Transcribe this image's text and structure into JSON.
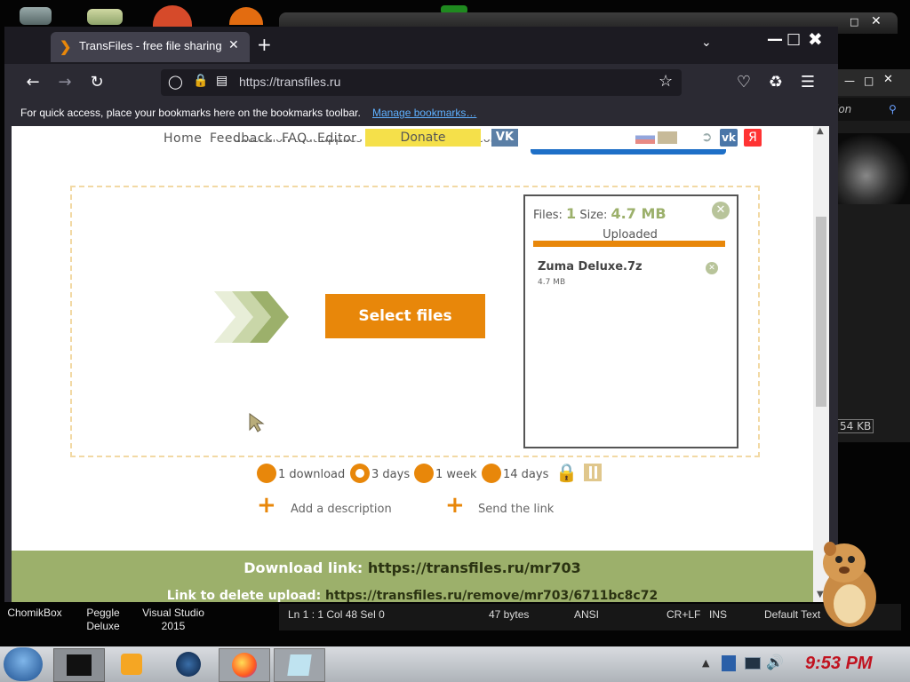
{
  "desktop": {
    "icons": [
      {
        "name": "ChomikBox",
        "label": "ChomikBox"
      },
      {
        "name": "Peggle Deluxe",
        "label_line1": "Peggle",
        "label_line2": "Deluxe"
      },
      {
        "name": "Visual Studio 2015",
        "label_line1": "Visual Studio",
        "label_line2": "2015"
      }
    ],
    "bg_window_search_text": "ion",
    "bg_window_size_text": "54 KB"
  },
  "editor_status": {
    "position": "Ln 1 : 1   Col 48   Sel 0",
    "bytes": "47 bytes",
    "encoding": "ANSI",
    "line_endings": "CR+LF",
    "mode": "INS",
    "syntax": "Default Text"
  },
  "browser": {
    "tab_title": "TransFiles - free file sharing s",
    "url": "https://transfiles.ru",
    "bookmarks_hint": "For quick access, place your bookmarks here on the bookmarks toolbar.",
    "bookmarks_link": "Manage bookmarks…"
  },
  "page": {
    "nav": {
      "home": "Home",
      "feedback": "Feedback",
      "faq": "FAQ",
      "editor": "Editor",
      "donate": "Donate",
      "vk": "VK"
    },
    "partial_text": "extension that applies coupon codes in seconds.",
    "select_files": "Select files",
    "panel": {
      "files_label": "Files:",
      "files_count": "1",
      "size_label": "Size:",
      "size_value": "4.7 MB",
      "status": "Uploaded",
      "progress": 1.0,
      "file_name": "Zuma Deluxe.7z",
      "file_size": "4.7 MB"
    },
    "options": {
      "one_download": "1 download",
      "three_days": "3 days",
      "one_week": "1 week",
      "fourteen_days": "14 days",
      "selected": "3 days"
    },
    "actions": {
      "add_description": "Add a description",
      "send_link": "Send the link"
    },
    "download_label": "Download link:",
    "download_url": "https://transfiles.ru/mr703",
    "delete_label": "Link to delete upload:",
    "delete_url": "https://transfiles.ru/remove/mr703/6711bc8c72"
  },
  "taskbar": {
    "clock": "9:53 PM"
  },
  "colors": {
    "accent_orange": "#e8870a",
    "green_bar": "#9cb06b",
    "donate_yellow": "#f5e04a",
    "vk_blue": "#4a76a8"
  }
}
